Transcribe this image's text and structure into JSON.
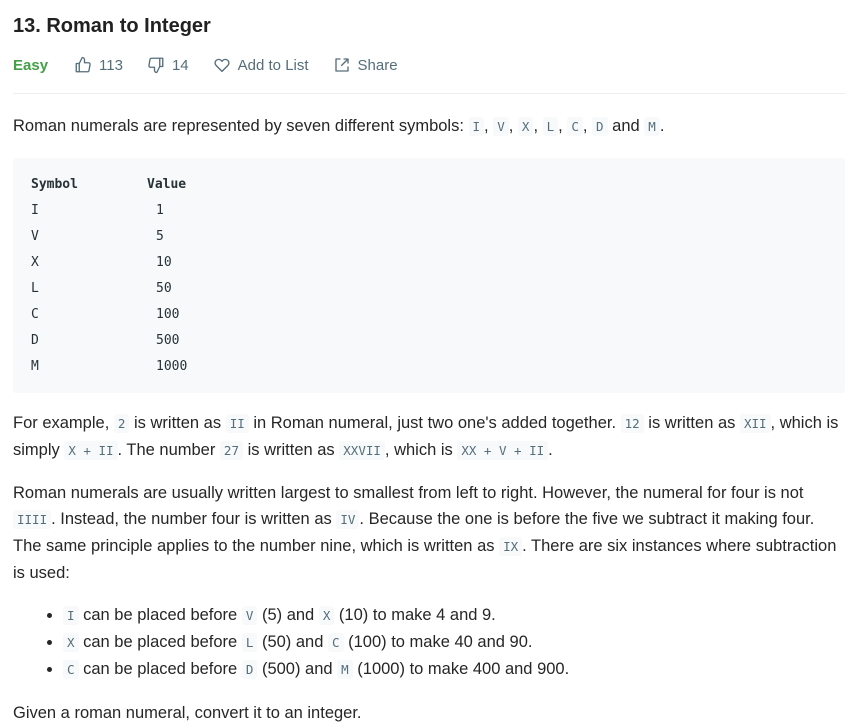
{
  "problem": {
    "title": "13. Roman to Integer",
    "difficulty": "Easy",
    "likes": "113",
    "dislikes": "14",
    "add_to_list_label": "Add to List",
    "share_label": "Share"
  },
  "colors": {
    "easy": "#43a047",
    "meta": "#546e7a",
    "code_bg": "#f7f9fa"
  },
  "description": {
    "intro_text": "Roman numerals are represented by seven different symbols: ",
    "intro_symbols": [
      "I",
      "V",
      "X",
      "L",
      "C",
      "D",
      "M"
    ],
    "intro_and": "and",
    "table": {
      "headers": [
        "Symbol",
        "Value"
      ],
      "rows": [
        [
          "I",
          "1"
        ],
        [
          "V",
          "5"
        ],
        [
          "X",
          "10"
        ],
        [
          "L",
          "50"
        ],
        [
          "C",
          "100"
        ],
        [
          "D",
          "500"
        ],
        [
          "M",
          "1000"
        ]
      ]
    },
    "example": {
      "t1": "For example, ",
      "c1": "2",
      "t2": " is written as ",
      "c2": "II",
      "t3": " in Roman numeral, just two one's added together. ",
      "c3": "12",
      "t4": " is written as ",
      "c4": "XII",
      "t5": ", which is simply ",
      "c5": "X + II",
      "t6": ". The number ",
      "c6": "27",
      "t7": " is written as ",
      "c7": "XXVII",
      "t8": ", which is ",
      "c8": "XX + V + II",
      "t9": "."
    },
    "subtraction": {
      "t1": "Roman numerals are usually written largest to smallest from left to right. However, the numeral for four is not ",
      "c1": "IIII",
      "t2": ". Instead, the number four is written as ",
      "c2": "IV",
      "t3": ". Because the one is before the five we subtract it making four. The same principle applies to the number nine, which is written as ",
      "c3": "IX",
      "t4": ". There are six instances where subtraction is used:"
    },
    "rules": [
      {
        "a": "I",
        "t1": " can be placed before ",
        "b": "V",
        "t2": " (5) and ",
        "c": "X",
        "t3": " (10) to make 4 and 9."
      },
      {
        "a": "X",
        "t1": " can be placed before ",
        "b": "L",
        "t2": " (50) and ",
        "c": "C",
        "t3": " (100) to make 40 and 90."
      },
      {
        "a": "C",
        "t1": " can be placed before ",
        "b": "D",
        "t2": " (500) and ",
        "c": "M",
        "t3": " (1000) to make 400 and 900."
      }
    ],
    "closing": "Given a roman numeral, convert it to an integer."
  }
}
